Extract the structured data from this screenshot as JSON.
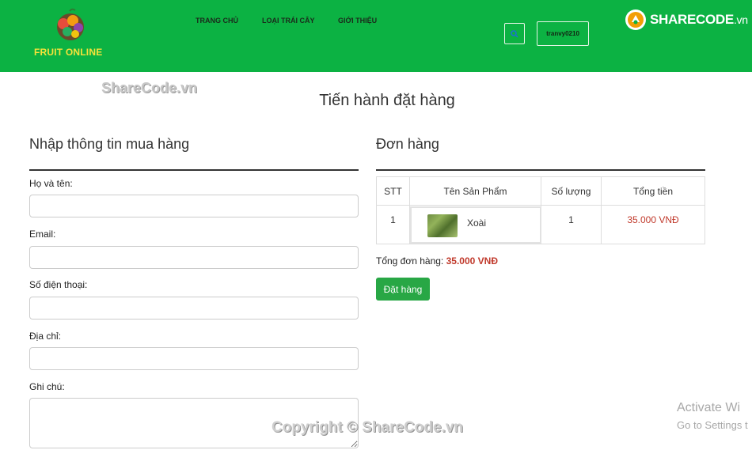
{
  "header": {
    "logo_text": "FRUIT ONLINE",
    "nav": [
      "TRANG CHỦ",
      "LOẠI TRÁI CÂY",
      "GIỚI THIỆU"
    ],
    "username": "tranvy0210",
    "search_icon": "search-icon",
    "brand_logo": {
      "share": "SHARE",
      "code": "CODE",
      "vn": ".vn"
    }
  },
  "watermarks": {
    "top": "ShareCode.vn",
    "bottom": "Copyright © ShareCode.vn"
  },
  "windows_notice": {
    "title": "Activate Wi",
    "subtitle": "Go to Settings t"
  },
  "page_title": "Tiến hành đặt hàng",
  "form": {
    "title": "Nhập thông tin mua hàng",
    "fields": [
      {
        "label": "Họ và tên:",
        "value": ""
      },
      {
        "label": "Email:",
        "value": ""
      },
      {
        "label": "Số điện thoại:",
        "value": ""
      },
      {
        "label": "Địa chỉ:",
        "value": ""
      },
      {
        "label": "Ghi chú:",
        "value": ""
      }
    ]
  },
  "order": {
    "title": "Đơn hàng",
    "columns": [
      "STT",
      "Tên Sản Phẩm",
      "Số lượng",
      "Tổng tiền"
    ],
    "rows": [
      {
        "stt": "1",
        "product": "Xoài",
        "qty": "1",
        "total": "35.000 VNĐ"
      }
    ],
    "total_label": "Tổng đơn hàng:",
    "total_value": "35.000 VNĐ",
    "submit_label": "Đặt hàng"
  },
  "colors": {
    "header": "#0cb243",
    "button": "#28a745",
    "price": "#c0392b"
  }
}
